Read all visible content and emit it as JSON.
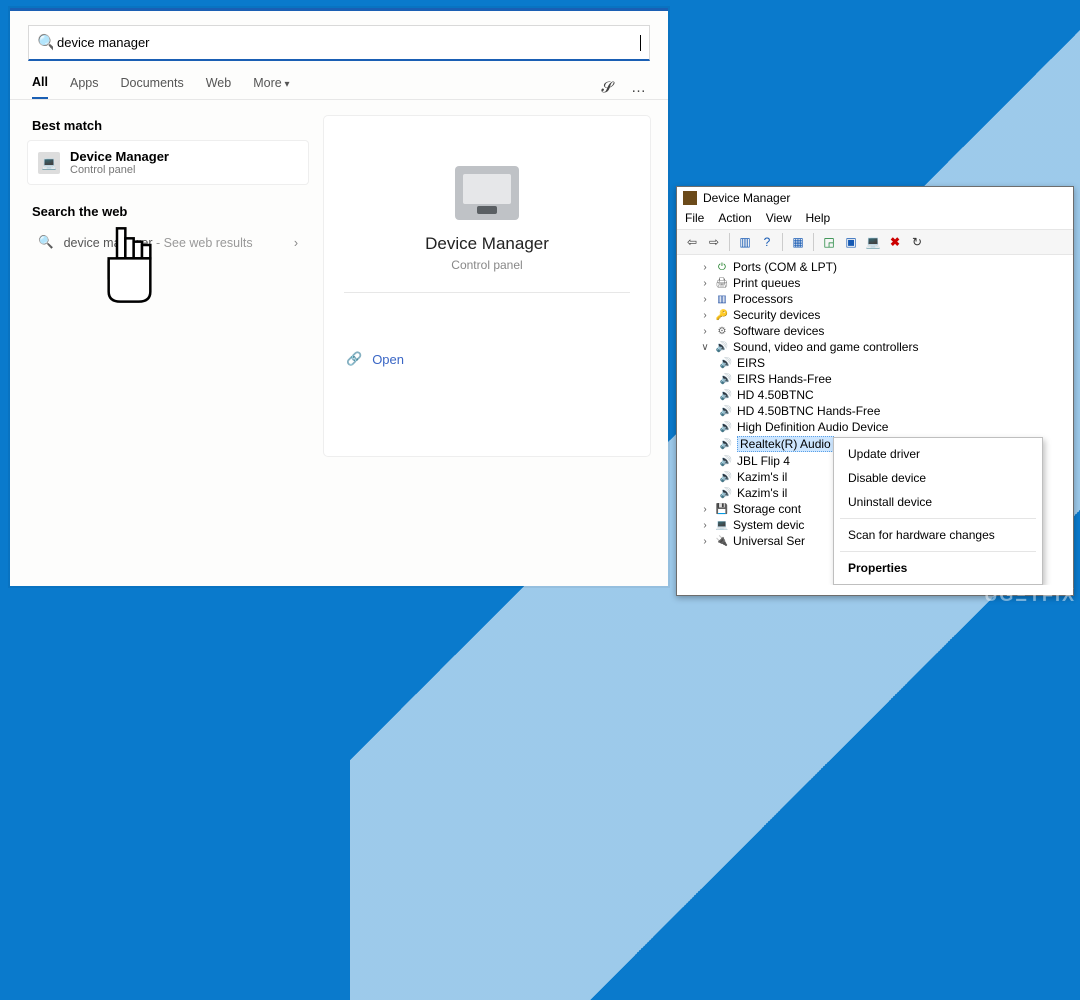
{
  "search_panel": {
    "query": "device manager",
    "tabs": [
      "All",
      "Apps",
      "Documents",
      "Web",
      "More"
    ],
    "best_match_label": "Best match",
    "best_match": {
      "title": "Device Manager",
      "subtitle": "Control panel"
    },
    "search_the_web_label": "Search the web",
    "web_row": {
      "query": "device manager",
      "action": "See web results"
    },
    "preview": {
      "title": "Device Manager",
      "subtitle": "Control panel",
      "open": "Open"
    }
  },
  "dm_window": {
    "title": "Device Manager",
    "menu": [
      "File",
      "Action",
      "View",
      "Help"
    ],
    "tree": {
      "Ports": "Ports (COM & LPT)",
      "PrintQueues": "Print queues",
      "Processors": "Processors",
      "Security": "Security devices",
      "Software": "Software devices",
      "Sound": "Sound, video and game controllers",
      "sound_children": [
        "EIRS",
        "EIRS Hands-Free",
        "HD 4.50BTNC",
        "HD 4.50BTNC Hands-Free",
        "High Definition Audio Device",
        "Realtek(R) Audio",
        "JBL Flip 4",
        "Kazim's il",
        "Kazim's il"
      ],
      "Storage": "Storage cont",
      "System": "System devic",
      "USB": "Universal Ser"
    },
    "context_menu": [
      "Update driver",
      "Disable device",
      "Uninstall device",
      "Scan for hardware changes",
      "Properties"
    ]
  },
  "watermark": "UGΞTFİX"
}
